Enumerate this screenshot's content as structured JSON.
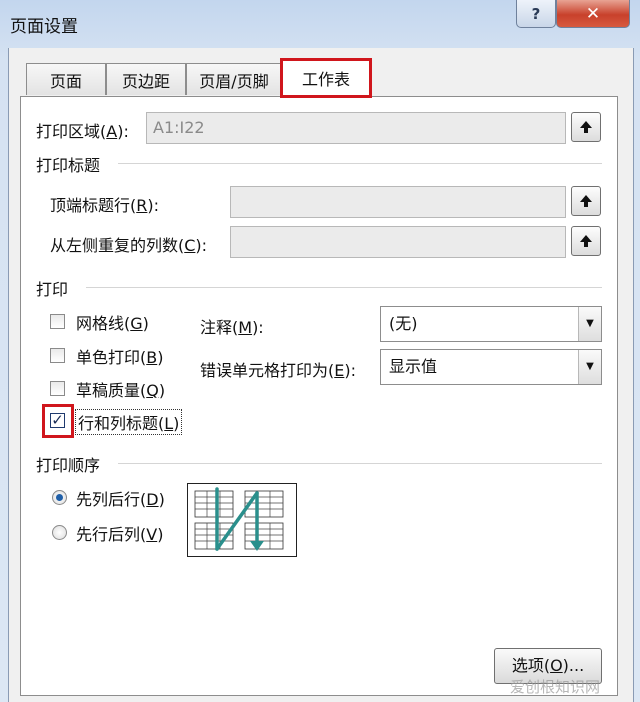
{
  "window": {
    "title": "页面设置",
    "help_label": "?",
    "close_label": "✕"
  },
  "tabs": [
    {
      "label": "页面"
    },
    {
      "label": "页边距"
    },
    {
      "label": "页眉/页脚"
    },
    {
      "label": "工作表"
    }
  ],
  "print_area": {
    "label": "打印区域(",
    "key": "A",
    "label_end": "):",
    "value": "A1:I22"
  },
  "print_titles": {
    "heading": "打印标题",
    "rows": {
      "label": "顶端标题行(",
      "key": "R",
      "label_end": "):",
      "value": ""
    },
    "cols": {
      "label": "从左侧重复的列数(",
      "key": "C",
      "label_end": "):",
      "value": ""
    }
  },
  "print": {
    "heading": "打印",
    "gridlines": {
      "label": "网格线(",
      "key": "G",
      "label_end": ")",
      "checked": false
    },
    "mono": {
      "label": "单色打印(",
      "key": "B",
      "label_end": ")",
      "checked": false
    },
    "draft": {
      "label": "草稿质量(",
      "key": "Q",
      "label_end": ")",
      "checked": false
    },
    "headings": {
      "label": "行和列标题(",
      "key": "L",
      "label_end": ")",
      "checked": true
    },
    "comments": {
      "label": "注释(",
      "key": "M",
      "label_end": "):",
      "value": "(无)"
    },
    "errors": {
      "label": "错误单元格打印为(",
      "key": "E",
      "label_end": "):",
      "value": "显示值"
    }
  },
  "order": {
    "heading": "打印顺序",
    "down_then_over": {
      "label": "先列后行(",
      "key": "D",
      "label_end": ")",
      "selected": true
    },
    "over_then_down": {
      "label": "先行后列(",
      "key": "V",
      "label_end": ")",
      "selected": false
    }
  },
  "options_button": {
    "label": "选项(",
    "key": "O",
    "label_end": ")..."
  },
  "watermark": "爱创根知识网",
  "colors": {
    "highlight": "#d0161c",
    "order_arrow": "#2a8f8c"
  }
}
